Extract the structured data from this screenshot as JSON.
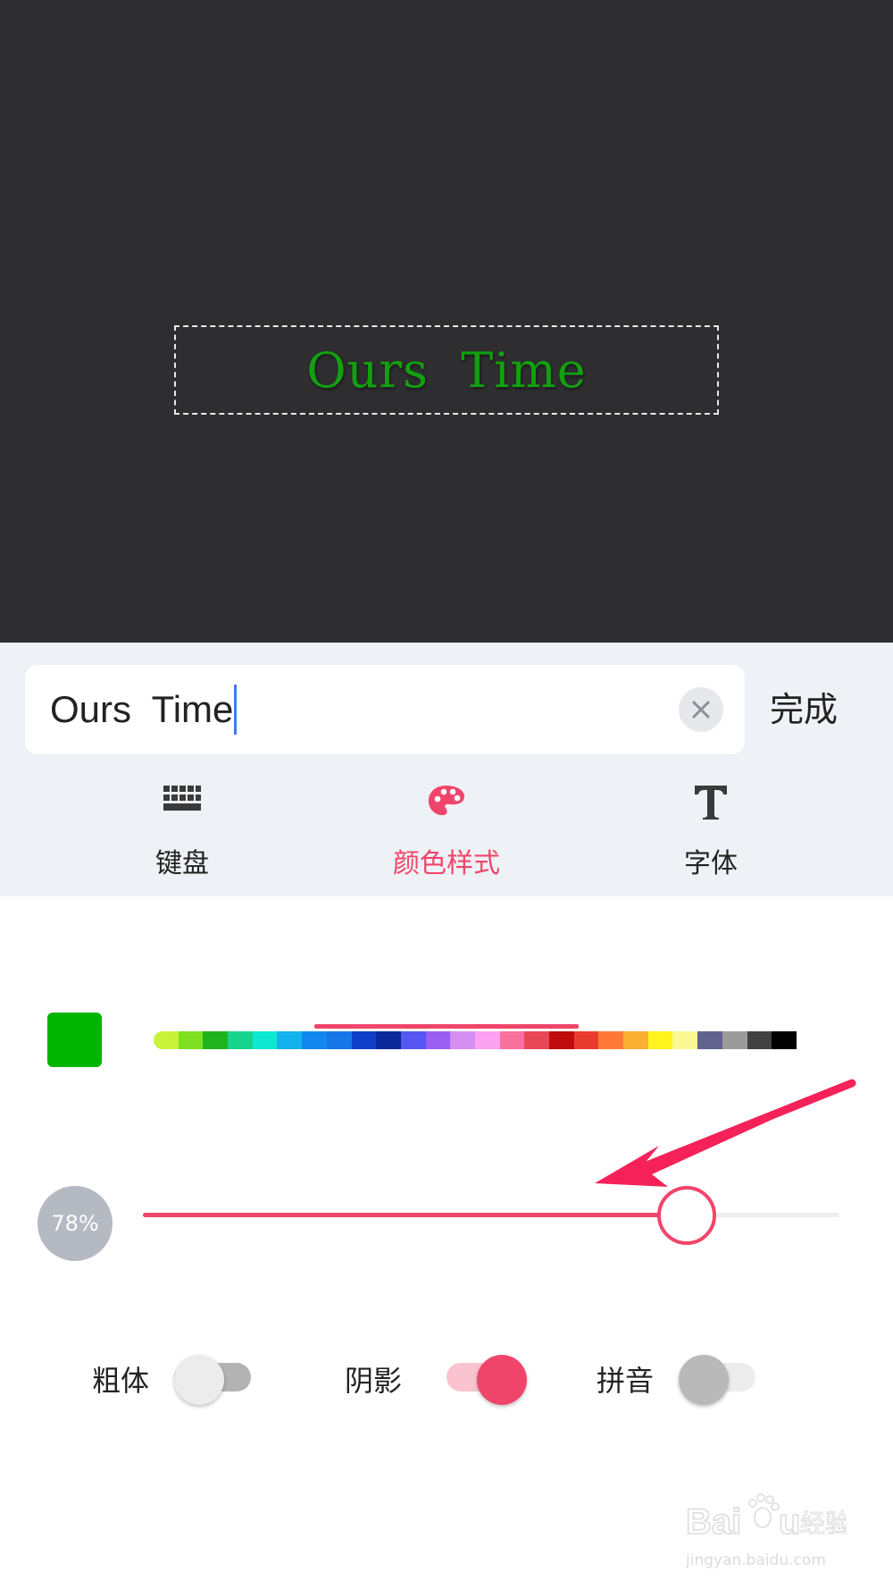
{
  "preview": {
    "text": "Ours  Time",
    "text_color": "#13a010"
  },
  "editor": {
    "input_value": "Ours  Time",
    "done_label": "完成",
    "clear_icon": "close-icon"
  },
  "tabs": [
    {
      "label": "键盘",
      "icon": "keyboard-icon",
      "active": false
    },
    {
      "label": "颜色样式",
      "icon": "palette-icon",
      "active": true
    },
    {
      "label": "字体",
      "icon": "font-icon",
      "active": false
    }
  ],
  "colors": {
    "selected": "#00b400",
    "palette": [
      "#c8f23a",
      "#7fe020",
      "#1fb31f",
      "#16d48c",
      "#0ee8d2",
      "#14b2ee",
      "#1288ee",
      "#1576e8",
      "#0f3fc8",
      "#0a2898",
      "#5656f2",
      "#9a5ef2",
      "#d68ef2",
      "#fba2f0",
      "#f7709e",
      "#e84758",
      "#c00c0c",
      "#ea3c2e",
      "#fe7a36",
      "#fbb034",
      "#fff41e",
      "#fbf894",
      "#62638c",
      "#9b9b9b",
      "#424242",
      "#000000"
    ],
    "accent": "#f0456a"
  },
  "opacity": {
    "label": "78%",
    "value": 0.78
  },
  "toggles": [
    {
      "label": "粗体",
      "on": false
    },
    {
      "label": "阴影",
      "on": true
    },
    {
      "label": "拼音",
      "on": false
    }
  ]
}
